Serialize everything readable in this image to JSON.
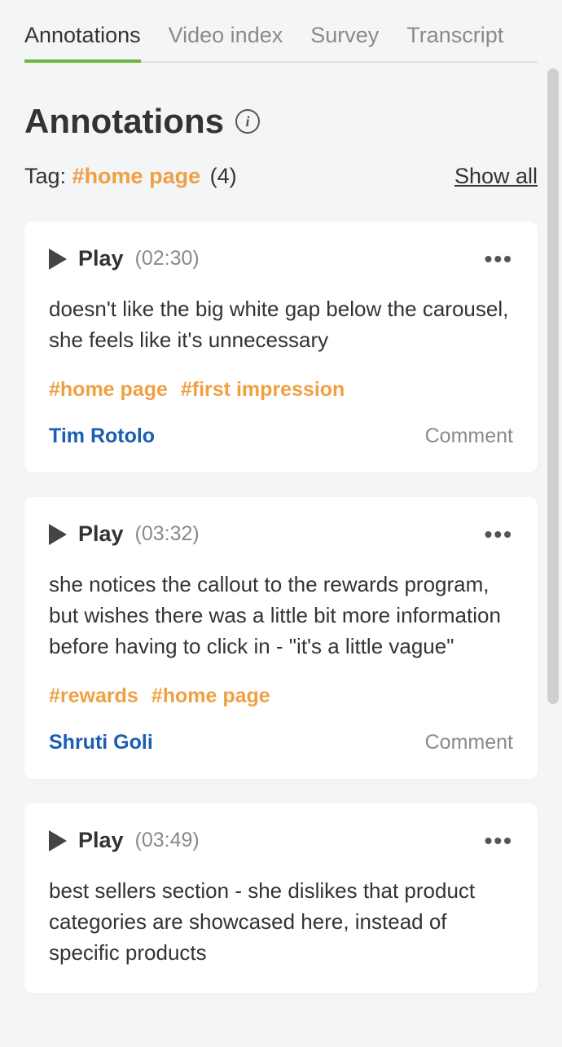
{
  "tabs": [
    {
      "label": "Annotations",
      "active": true
    },
    {
      "label": "Video index",
      "active": false
    },
    {
      "label": "Survey",
      "active": false
    },
    {
      "label": "Transcript",
      "active": false
    }
  ],
  "header": {
    "title": "Annotations"
  },
  "filter": {
    "prefix": "Tag: ",
    "tag": "#home page",
    "count": "(4)",
    "show_all": "Show all"
  },
  "play_label": "Play",
  "comment_label": "Comment",
  "cards": [
    {
      "timestamp": "(02:30)",
      "body": "doesn't like the big white gap below the carousel, she feels like it's unnecessary",
      "tags": [
        "#home page",
        "#first impression"
      ],
      "author": "Tim Rotolo"
    },
    {
      "timestamp": "(03:32)",
      "body": "she notices the callout to the rewards program, but wishes there was a little bit more information before having to click in - \"it's a little vague\"",
      "tags": [
        "#rewards",
        "#home page"
      ],
      "author": "Shruti Goli"
    },
    {
      "timestamp": "(03:49)",
      "body": "best sellers section - she dislikes that product categories are showcased here, instead of specific products",
      "tags": [],
      "author": ""
    }
  ]
}
